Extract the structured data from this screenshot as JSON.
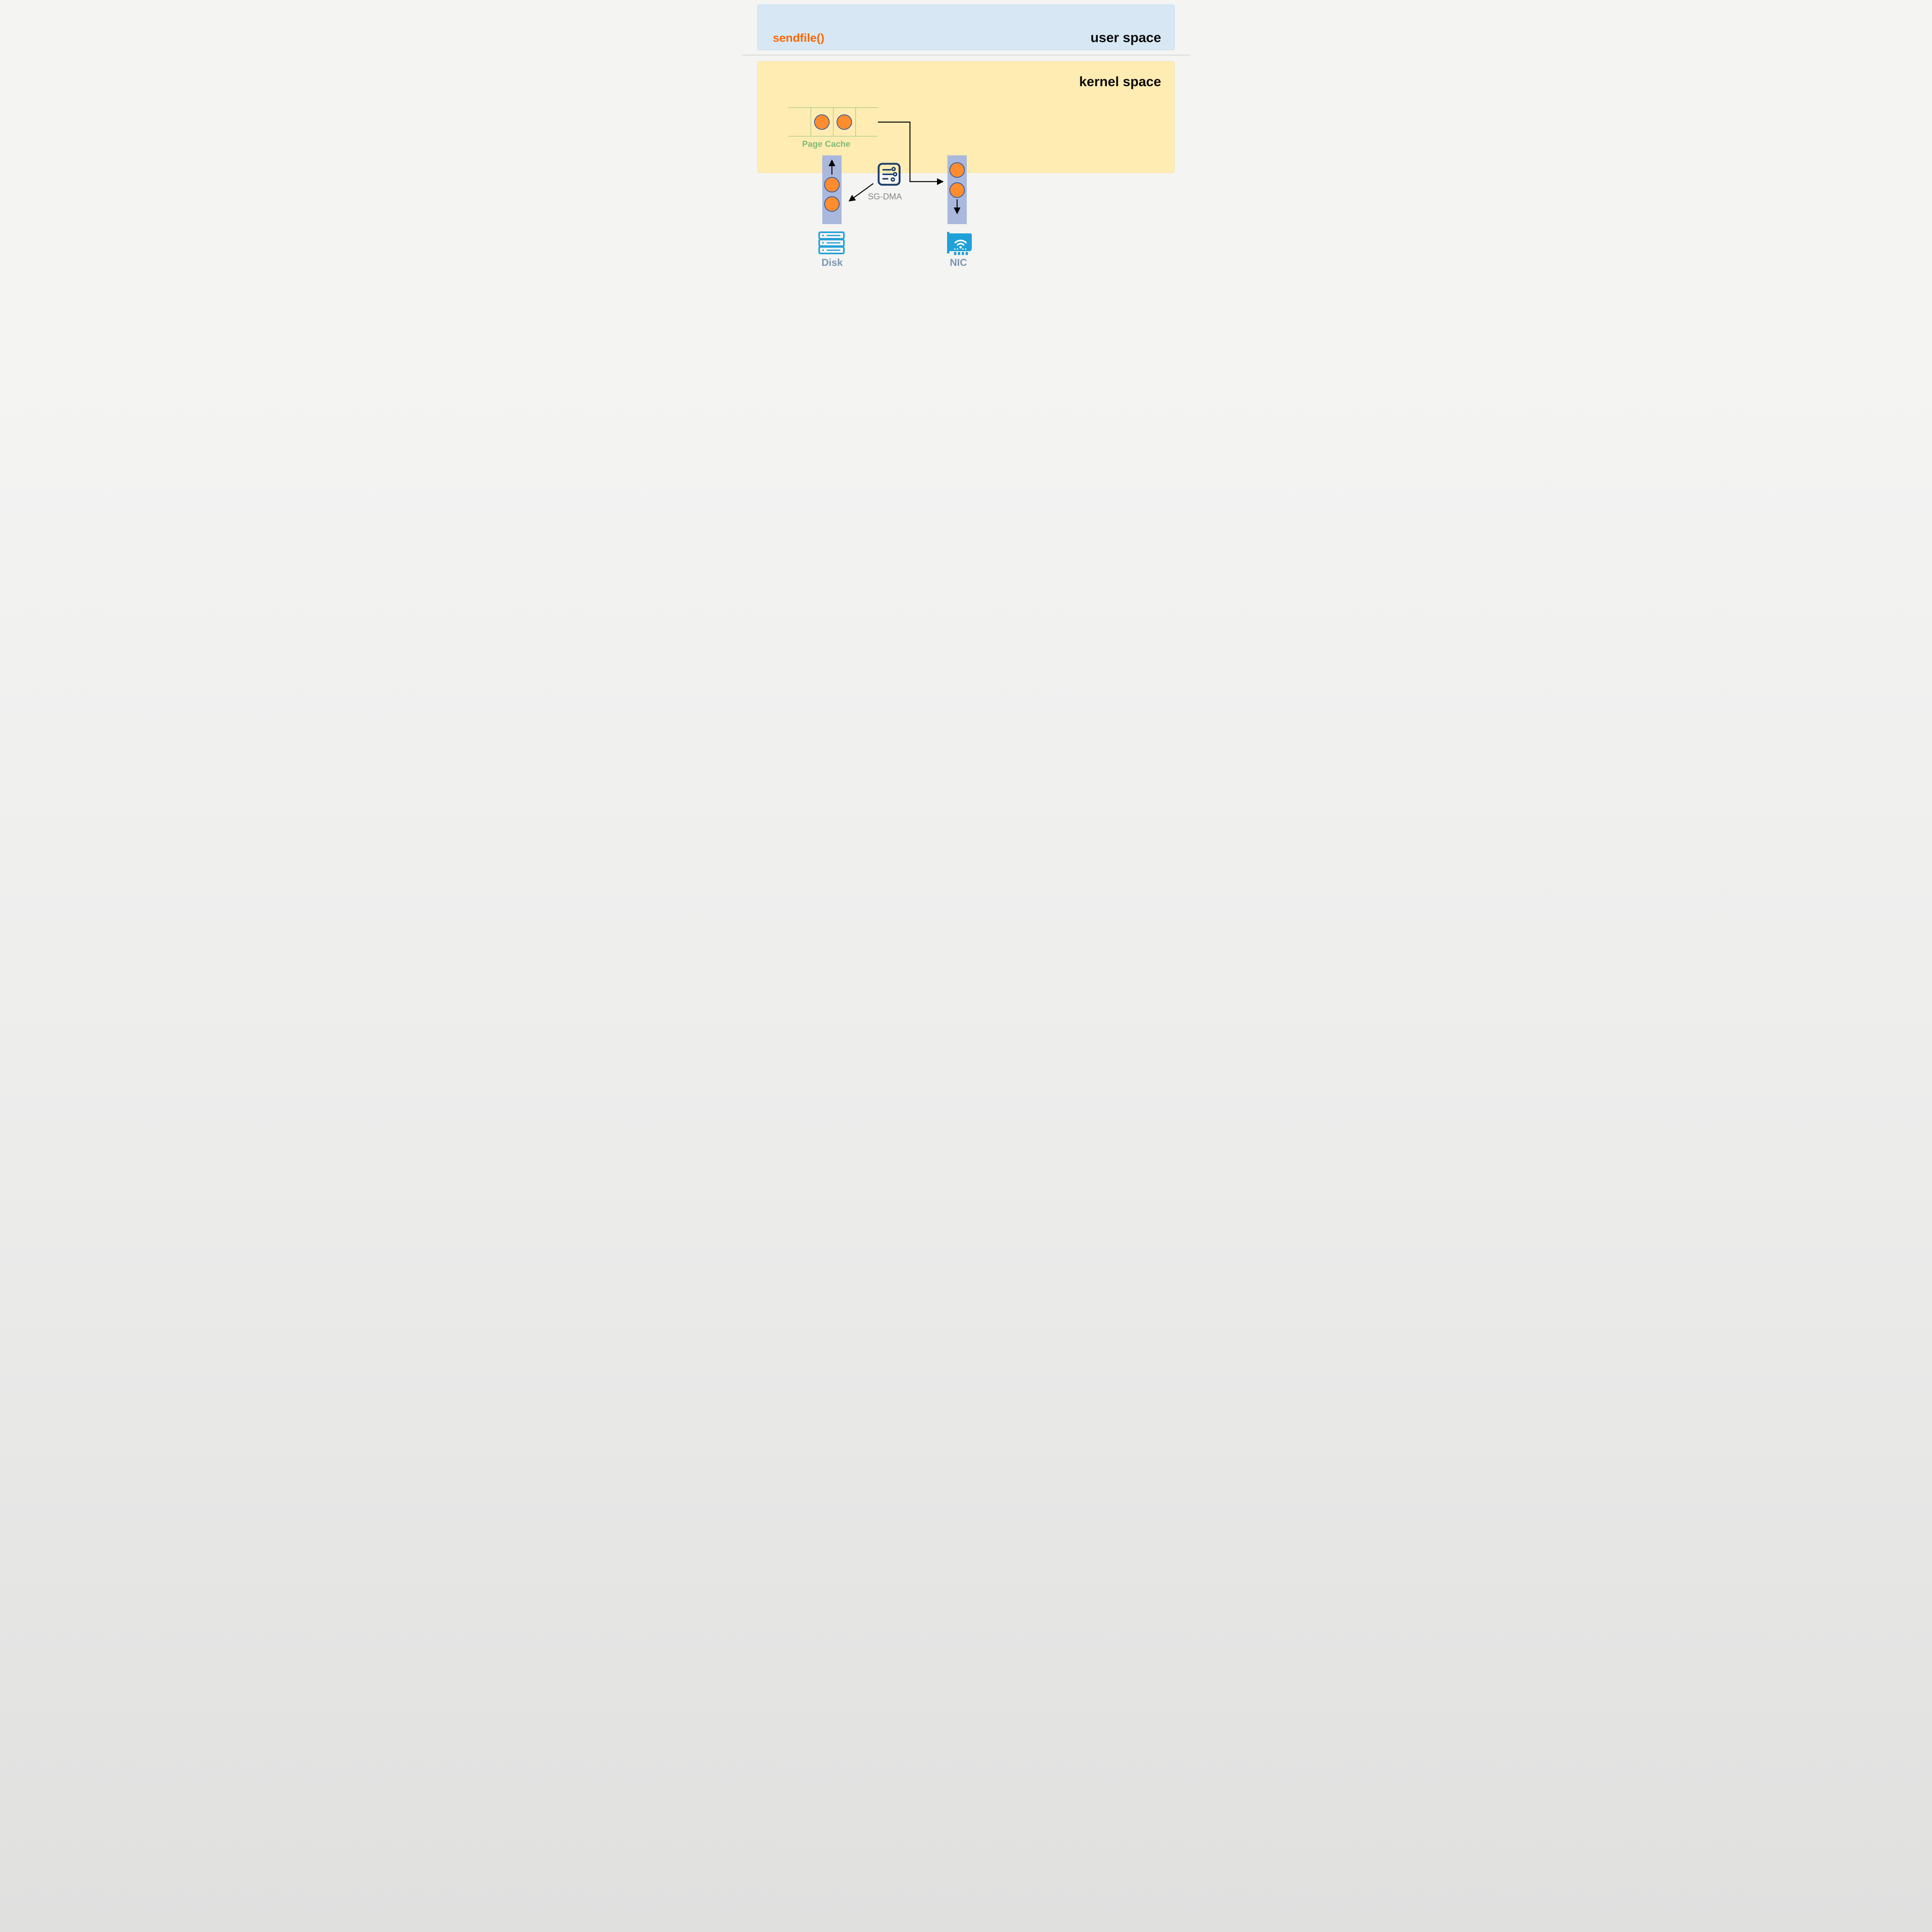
{
  "userSpace": {
    "title": "user space",
    "syscall": "sendfile()"
  },
  "kernelSpace": {
    "title": "kernel space",
    "pageCache": {
      "label": "Page Cache"
    },
    "sgdma": {
      "label": "SG-DMA"
    }
  },
  "devices": {
    "disk": {
      "label": "Disk"
    },
    "nic": {
      "label": "NIC"
    }
  },
  "colors": {
    "accentOrange": "#ff6600",
    "dotFill": "#ff8c2e",
    "dotBorder": "#32589b",
    "boxUser": "#d7e8f4",
    "boxKernel": "#ffecb2",
    "columnFill": "#a9b8dc",
    "pageCacheGreen": "#7fbb77",
    "deviceLabel": "#7a97ae",
    "iconBlue": "#20a0d8",
    "iconNavy": "#1d3d6b",
    "sgdmaText": "#888888"
  }
}
